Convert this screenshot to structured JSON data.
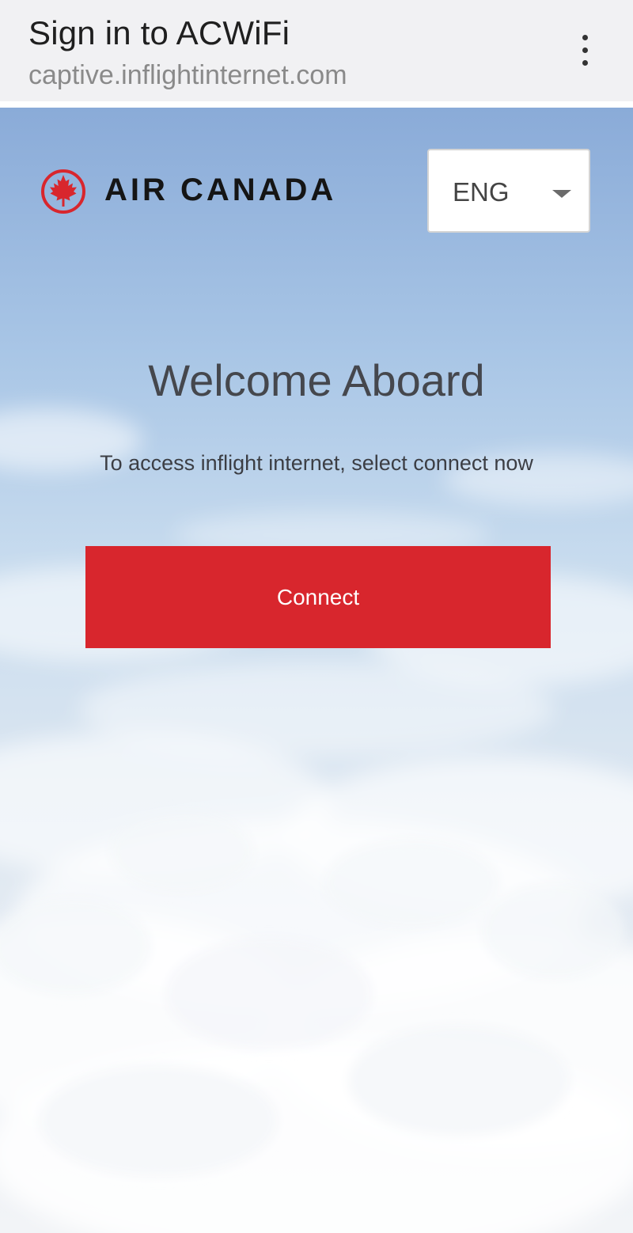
{
  "browser": {
    "title": "Sign in to ACWiFi",
    "url": "captive.inflightinternet.com",
    "menu_icon": "more-vertical-icon"
  },
  "header": {
    "logo_text": "AIR CANADA",
    "logo_icon": "maple-leaf-roundel-icon",
    "language": {
      "selected": "ENG",
      "icon": "caret-down-icon"
    }
  },
  "main": {
    "heading": "Welcome Aboard",
    "subtitle": "To access inflight internet, select connect now",
    "connect_label": "Connect"
  },
  "colors": {
    "accent": "#d8262d",
    "topbar_bg": "#f1f1f3",
    "sky_top": "#8aabd8",
    "heading_text": "#45474d"
  }
}
